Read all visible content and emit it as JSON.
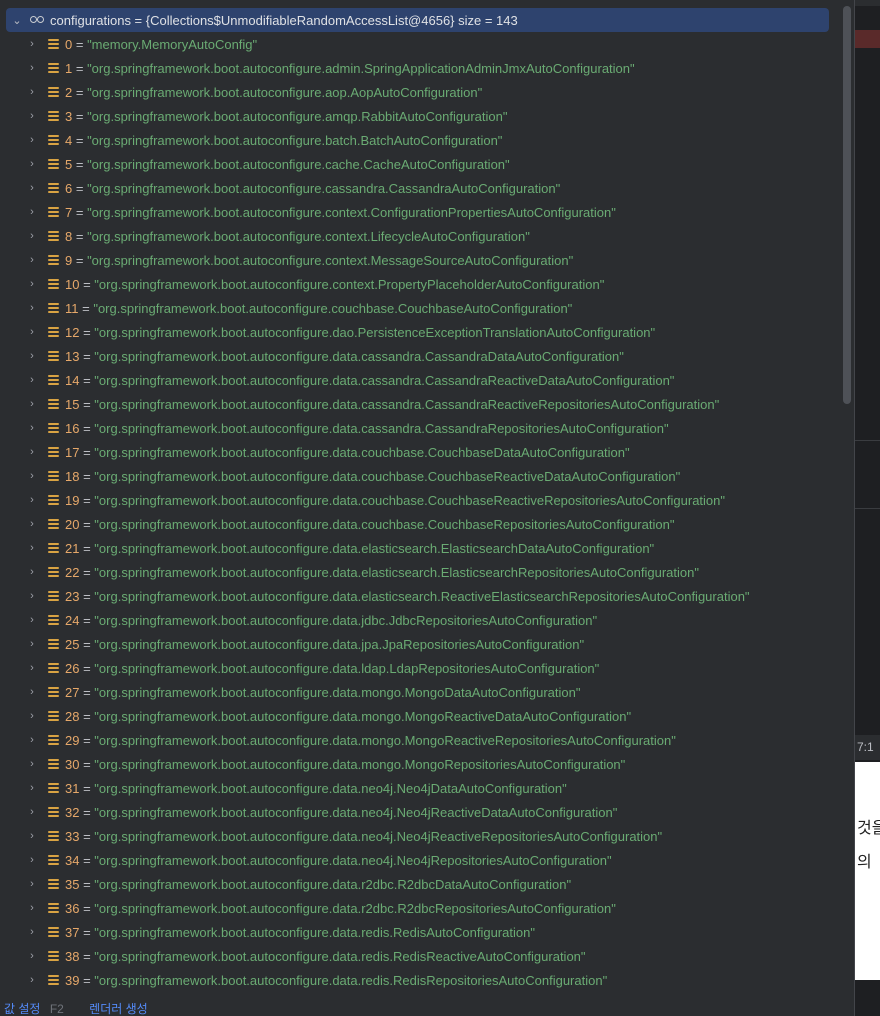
{
  "root": {
    "label": "configurations = {Collections$UnmodifiableRandomAccessList@4656}  size = 143"
  },
  "items": [
    {
      "index": "0",
      "value": "\"memory.MemoryAutoConfig\""
    },
    {
      "index": "1",
      "value": "\"org.springframework.boot.autoconfigure.admin.SpringApplicationAdminJmxAutoConfiguration\""
    },
    {
      "index": "2",
      "value": "\"org.springframework.boot.autoconfigure.aop.AopAutoConfiguration\""
    },
    {
      "index": "3",
      "value": "\"org.springframework.boot.autoconfigure.amqp.RabbitAutoConfiguration\""
    },
    {
      "index": "4",
      "value": "\"org.springframework.boot.autoconfigure.batch.BatchAutoConfiguration\""
    },
    {
      "index": "5",
      "value": "\"org.springframework.boot.autoconfigure.cache.CacheAutoConfiguration\""
    },
    {
      "index": "6",
      "value": "\"org.springframework.boot.autoconfigure.cassandra.CassandraAutoConfiguration\""
    },
    {
      "index": "7",
      "value": "\"org.springframework.boot.autoconfigure.context.ConfigurationPropertiesAutoConfiguration\""
    },
    {
      "index": "8",
      "value": "\"org.springframework.boot.autoconfigure.context.LifecycleAutoConfiguration\""
    },
    {
      "index": "9",
      "value": "\"org.springframework.boot.autoconfigure.context.MessageSourceAutoConfiguration\""
    },
    {
      "index": "10",
      "value": "\"org.springframework.boot.autoconfigure.context.PropertyPlaceholderAutoConfiguration\""
    },
    {
      "index": "11",
      "value": "\"org.springframework.boot.autoconfigure.couchbase.CouchbaseAutoConfiguration\""
    },
    {
      "index": "12",
      "value": "\"org.springframework.boot.autoconfigure.dao.PersistenceExceptionTranslationAutoConfiguration\""
    },
    {
      "index": "13",
      "value": "\"org.springframework.boot.autoconfigure.data.cassandra.CassandraDataAutoConfiguration\""
    },
    {
      "index": "14",
      "value": "\"org.springframework.boot.autoconfigure.data.cassandra.CassandraReactiveDataAutoConfiguration\""
    },
    {
      "index": "15",
      "value": "\"org.springframework.boot.autoconfigure.data.cassandra.CassandraReactiveRepositoriesAutoConfiguration\""
    },
    {
      "index": "16",
      "value": "\"org.springframework.boot.autoconfigure.data.cassandra.CassandraRepositoriesAutoConfiguration\""
    },
    {
      "index": "17",
      "value": "\"org.springframework.boot.autoconfigure.data.couchbase.CouchbaseDataAutoConfiguration\""
    },
    {
      "index": "18",
      "value": "\"org.springframework.boot.autoconfigure.data.couchbase.CouchbaseReactiveDataAutoConfiguration\""
    },
    {
      "index": "19",
      "value": "\"org.springframework.boot.autoconfigure.data.couchbase.CouchbaseReactiveRepositoriesAutoConfiguration\""
    },
    {
      "index": "20",
      "value": "\"org.springframework.boot.autoconfigure.data.couchbase.CouchbaseRepositoriesAutoConfiguration\""
    },
    {
      "index": "21",
      "value": "\"org.springframework.boot.autoconfigure.data.elasticsearch.ElasticsearchDataAutoConfiguration\""
    },
    {
      "index": "22",
      "value": "\"org.springframework.boot.autoconfigure.data.elasticsearch.ElasticsearchRepositoriesAutoConfiguration\""
    },
    {
      "index": "23",
      "value": "\"org.springframework.boot.autoconfigure.data.elasticsearch.ReactiveElasticsearchRepositoriesAutoConfiguration\""
    },
    {
      "index": "24",
      "value": "\"org.springframework.boot.autoconfigure.data.jdbc.JdbcRepositoriesAutoConfiguration\""
    },
    {
      "index": "25",
      "value": "\"org.springframework.boot.autoconfigure.data.jpa.JpaRepositoriesAutoConfiguration\""
    },
    {
      "index": "26",
      "value": "\"org.springframework.boot.autoconfigure.data.ldap.LdapRepositoriesAutoConfiguration\""
    },
    {
      "index": "27",
      "value": "\"org.springframework.boot.autoconfigure.data.mongo.MongoDataAutoConfiguration\""
    },
    {
      "index": "28",
      "value": "\"org.springframework.boot.autoconfigure.data.mongo.MongoReactiveDataAutoConfiguration\""
    },
    {
      "index": "29",
      "value": "\"org.springframework.boot.autoconfigure.data.mongo.MongoReactiveRepositoriesAutoConfiguration\""
    },
    {
      "index": "30",
      "value": "\"org.springframework.boot.autoconfigure.data.mongo.MongoRepositoriesAutoConfiguration\""
    },
    {
      "index": "31",
      "value": "\"org.springframework.boot.autoconfigure.data.neo4j.Neo4jDataAutoConfiguration\""
    },
    {
      "index": "32",
      "value": "\"org.springframework.boot.autoconfigure.data.neo4j.Neo4jReactiveDataAutoConfiguration\""
    },
    {
      "index": "33",
      "value": "\"org.springframework.boot.autoconfigure.data.neo4j.Neo4jReactiveRepositoriesAutoConfiguration\""
    },
    {
      "index": "34",
      "value": "\"org.springframework.boot.autoconfigure.data.neo4j.Neo4jRepositoriesAutoConfiguration\""
    },
    {
      "index": "35",
      "value": "\"org.springframework.boot.autoconfigure.data.r2dbc.R2dbcDataAutoConfiguration\""
    },
    {
      "index": "36",
      "value": "\"org.springframework.boot.autoconfigure.data.r2dbc.R2dbcRepositoriesAutoConfiguration\""
    },
    {
      "index": "37",
      "value": "\"org.springframework.boot.autoconfigure.data.redis.RedisAutoConfiguration\""
    },
    {
      "index": "38",
      "value": "\"org.springframework.boot.autoconfigure.data.redis.RedisReactiveAutoConfiguration\""
    },
    {
      "index": "39",
      "value": "\"org.springframework.boot.autoconfigure.data.redis.RedisRepositoriesAutoConfiguration\""
    }
  ],
  "footer": {
    "set_value_label": "값 설정",
    "set_value_shortcut": "F2",
    "render_label": "렌더러 생성"
  },
  "background": {
    "status_text": "7:1",
    "doc_line_1": "것을",
    "doc_line_2": "의 "
  },
  "icons": {
    "root": "watch-glasses-icon",
    "item": "list-stack-icon",
    "expanded": "chevron-down-icon",
    "collapsed": "chevron-right-icon"
  },
  "colors": {
    "popup_bg": "#2b2d30",
    "selection_bg": "#2e436e",
    "index": "#e6a86a",
    "string_value": "#6aab73",
    "link": "#548af7",
    "stack_icon": "#d9a343"
  }
}
